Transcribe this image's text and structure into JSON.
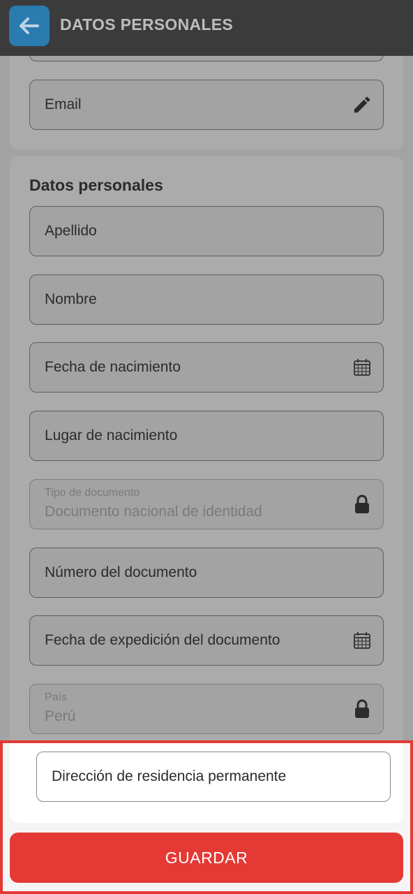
{
  "header": {
    "title": "DATOS PERSONALES",
    "back_icon": "arrow-left-icon"
  },
  "contact": {
    "email_label": "Email",
    "email_icon": "pencil-icon"
  },
  "personal": {
    "section_title": "Datos personales",
    "apellido_label": "Apellido",
    "nombre_label": "Nombre",
    "fecha_nacimiento_label": "Fecha de nacimiento",
    "lugar_nacimiento_label": "Lugar de nacimiento",
    "tipo_documento_label": "Tipo de documento",
    "tipo_documento_value": "Documento nacional de identidad",
    "numero_documento_label": "Número del documento",
    "fecha_expedicion_label": "Fecha de expedición del documento",
    "pais_label": "País",
    "pais_value": "Perú",
    "direccion_label": "Dirección de residencia permanente"
  },
  "actions": {
    "save_label": "GUARDAR"
  },
  "colors": {
    "accent": "#e53935",
    "back_button": "#2a7bb0",
    "header_bg": "#3b3b3b"
  }
}
